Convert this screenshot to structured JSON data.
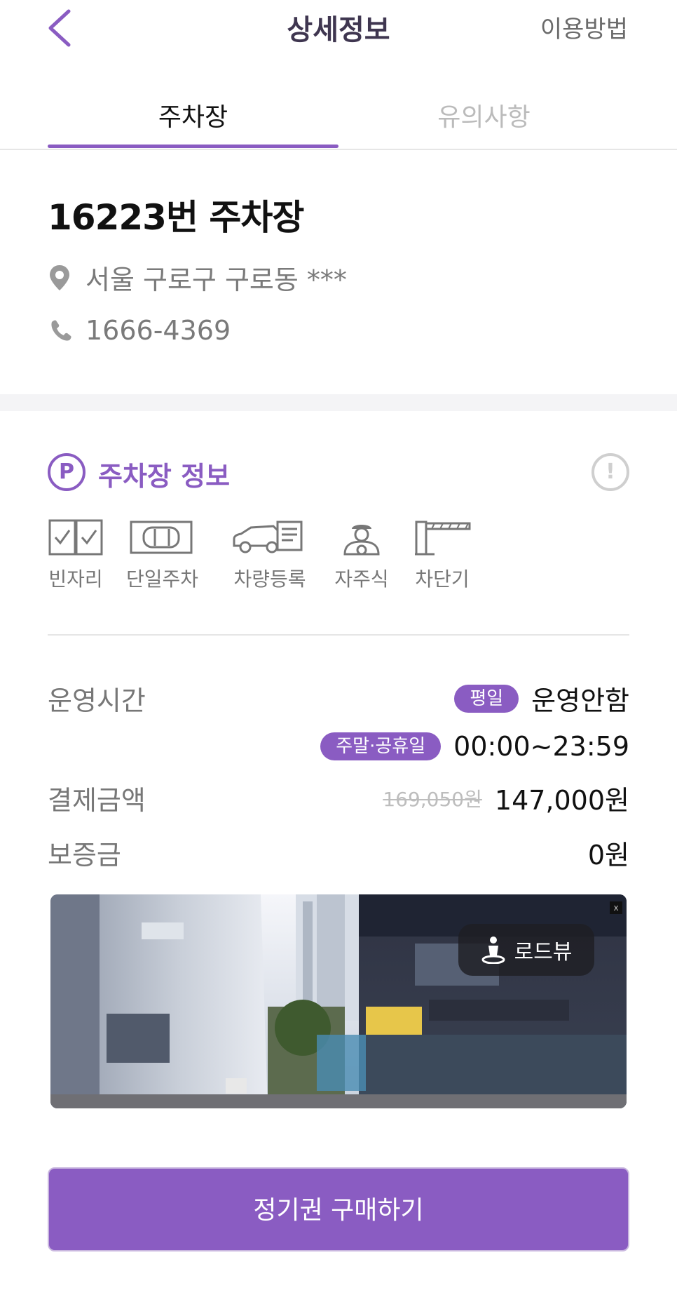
{
  "header": {
    "title": "상세정보",
    "help_label": "이용방법"
  },
  "tabs": [
    {
      "label": "주차장",
      "active": true
    },
    {
      "label": "유의사항",
      "active": false
    }
  ],
  "lot": {
    "name": "16223번 주차장",
    "address": "서울 구로구 구로동 ***",
    "phone": "1666-4369"
  },
  "section": {
    "title": "주차장 정보",
    "badge": "P"
  },
  "features": [
    {
      "label": "빈자리",
      "icon": "vacancy-icon"
    },
    {
      "label": "단일주차",
      "icon": "single-parking-icon"
    },
    {
      "label": "차량등록",
      "icon": "vehicle-registration-icon"
    },
    {
      "label": "자주식",
      "icon": "self-park-icon"
    },
    {
      "label": "차단기",
      "icon": "barrier-gate-icon"
    }
  ],
  "hours": {
    "label": "운영시간",
    "weekday_tag": "평일",
    "weekday_value": "운영안함",
    "weekend_tag": "주말·공휴일",
    "weekend_value": "00:00~23:59"
  },
  "payment": {
    "label": "결제금액",
    "original": "169,050원",
    "price": "147,000원"
  },
  "deposit": {
    "label": "보증금",
    "value": "0원"
  },
  "roadview": {
    "label": "로드뷰"
  },
  "cta": {
    "label": "정기권 구매하기"
  },
  "colors": {
    "accent": "#8a5cc2",
    "title": "#3f3650",
    "muted": "#777777"
  }
}
